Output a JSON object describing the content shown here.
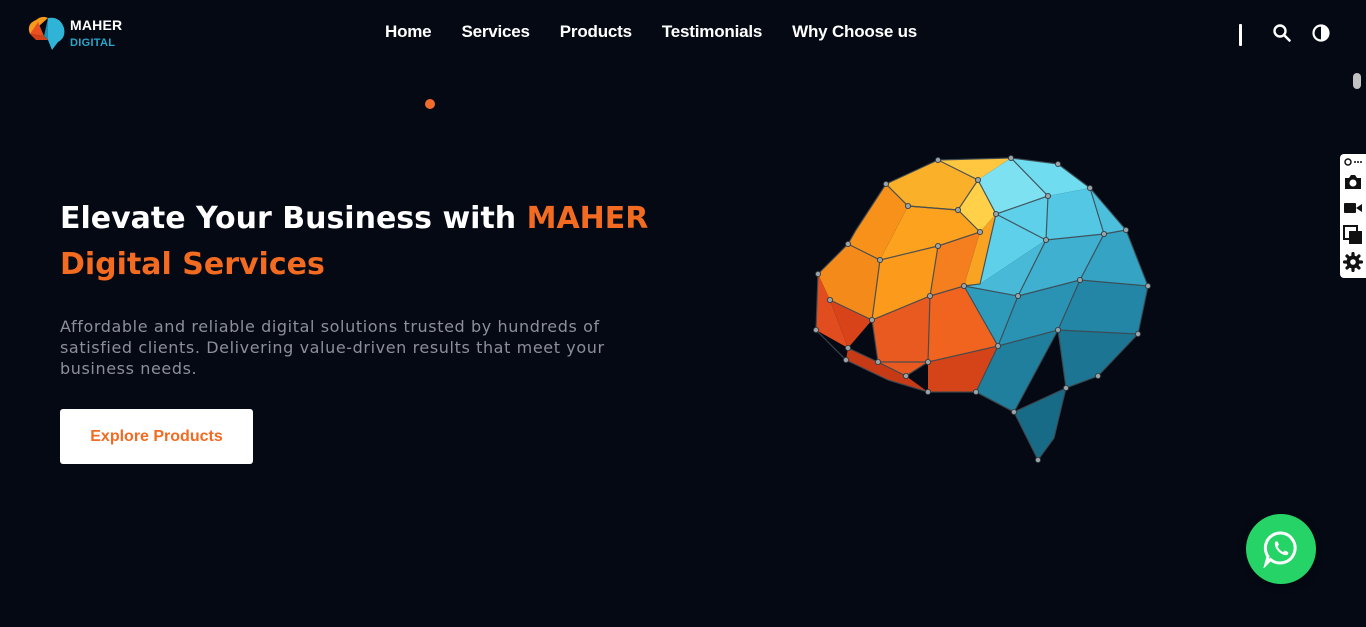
{
  "brand": {
    "line1": "MAHER",
    "line2": "DIGITAL",
    "accent_color": "#f26b21",
    "secondary_color": "#28a7c9"
  },
  "nav": {
    "items": [
      {
        "label": "Home"
      },
      {
        "label": "Services"
      },
      {
        "label": "Products"
      },
      {
        "label": "Testimonials"
      },
      {
        "label": "Why Choose us"
      }
    ],
    "icons": [
      "search-icon",
      "contrast-icon"
    ]
  },
  "hero": {
    "title_part1": "Elevate Your Business with ",
    "title_accent": "MAHER Digital Services",
    "description": "Affordable and reliable digital solutions trusted by hundreds of satisfied clients. Delivering value-driven results that meet your business needs.",
    "cta_label": "Explore Products",
    "image": "low-poly-brain-illustration"
  },
  "side_tools": {
    "icons": [
      "link-more-icon",
      "camera-icon",
      "video-icon",
      "window-icon",
      "settings-icon"
    ]
  },
  "floating": {
    "icon": "whatsapp-icon",
    "color": "#25d366"
  },
  "colors": {
    "background": "#050914",
    "text_muted": "#8c8f97"
  }
}
